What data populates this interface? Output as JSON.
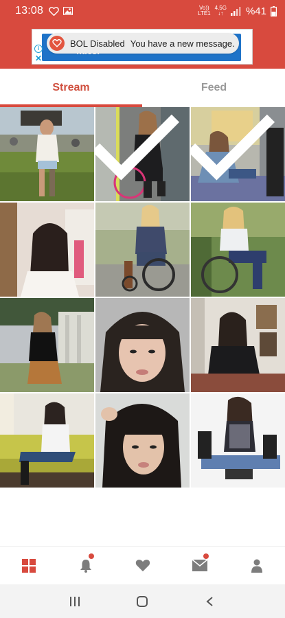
{
  "status_bar": {
    "time": "13:08",
    "net_top": "Vo))",
    "net_bottom": "LTE1",
    "net_speed": "4.5G",
    "battery": "%41",
    "icons": [
      "heart-outline-icon",
      "image-icon",
      "signal-icon",
      "battery-icon"
    ]
  },
  "ad": {
    "text": "fitiesi",
    "info_icon": "i",
    "close_icon": "✕"
  },
  "toast": {
    "title": "BOL Disabled",
    "message": "You have a new message."
  },
  "tabs": [
    {
      "label": "Stream",
      "active": true
    },
    {
      "label": "Feed",
      "active": false
    }
  ],
  "grid": {
    "tiles": [
      {
        "id": 1,
        "scene": "outdoor festival",
        "checked": false
      },
      {
        "id": 2,
        "scene": "subway wheelchair",
        "checked": true
      },
      {
        "id": 3,
        "scene": "subway seat",
        "checked": true
      },
      {
        "id": 4,
        "scene": "bedroom selfie",
        "checked": false
      },
      {
        "id": 5,
        "scene": "outdoor wheelchair",
        "checked": false
      },
      {
        "id": 6,
        "scene": "garden wheelchair",
        "checked": false
      },
      {
        "id": 7,
        "scene": "museum steps",
        "checked": false
      },
      {
        "id": 8,
        "scene": "closeup portrait",
        "checked": false
      },
      {
        "id": 9,
        "scene": "living room",
        "checked": false
      },
      {
        "id": 10,
        "scene": "couch sitting",
        "checked": false
      },
      {
        "id": 11,
        "scene": "bangs portrait",
        "checked": false
      },
      {
        "id": 12,
        "scene": "floor sitting",
        "checked": false
      }
    ]
  },
  "bottom_nav": [
    {
      "icon": "grid-icon",
      "active": true,
      "badge": false
    },
    {
      "icon": "bell-icon",
      "active": false,
      "badge": true
    },
    {
      "icon": "heart-icon",
      "active": false,
      "badge": false
    },
    {
      "icon": "mail-icon",
      "active": false,
      "badge": true
    },
    {
      "icon": "profile-icon",
      "active": false,
      "badge": false
    }
  ],
  "colors": {
    "brand_red": "#d84a3e",
    "inactive_gray": "#9a9a9a",
    "icon_gray": "#7d7d7d"
  }
}
